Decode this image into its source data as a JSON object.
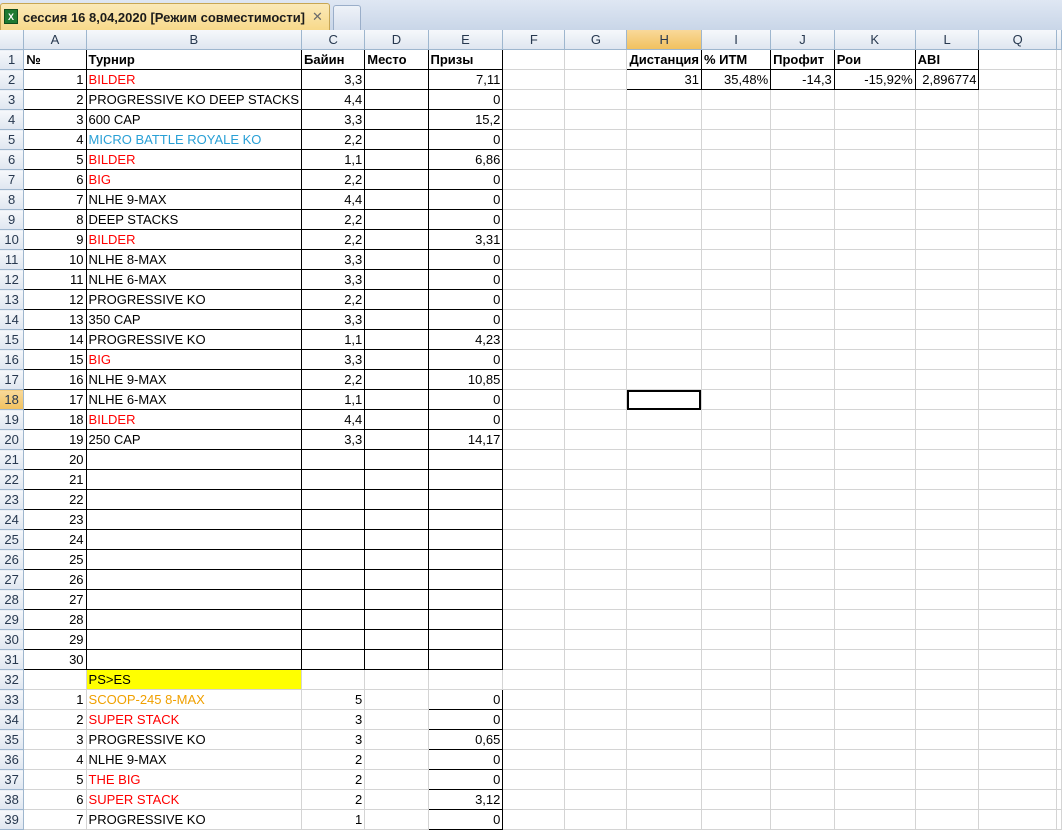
{
  "tab": {
    "title": "сессия 16 8,04,2020  [Режим совместимости]",
    "close": "✕"
  },
  "columns": [
    "A",
    "B",
    "C",
    "D",
    "E",
    "F",
    "G",
    "H",
    "I",
    "J",
    "K",
    "L",
    "Q"
  ],
  "header_row": {
    "A": "№",
    "B": "Турнир",
    "C": "Байин",
    "D": "Место",
    "E": "Призы",
    "H": "Дистанция",
    "I": "% ИТМ",
    "J": "Профит",
    "K": "Рои",
    "L": "ABI"
  },
  "summary_row": {
    "H": "31",
    "I": "35,48%",
    "J": "-14,3",
    "K": "-15,92%",
    "L": "2,896774"
  },
  "tournaments": [
    {
      "n": "1",
      "name": "BILDER",
      "color": "red",
      "buyin": "3,3",
      "prize": "7,11"
    },
    {
      "n": "2",
      "name": "PROGRESSIVE KO DEEP STACKS",
      "color": "black",
      "buyin": "4,4",
      "prize": "0"
    },
    {
      "n": "3",
      "name": "600 CAP",
      "color": "black",
      "buyin": "3,3",
      "prize": "15,2"
    },
    {
      "n": "4",
      "name": "MICRO BATTLE ROYALE KO",
      "color": "blue",
      "buyin": "2,2",
      "prize": "0"
    },
    {
      "n": "5",
      "name": "BILDER",
      "color": "red",
      "buyin": "1,1",
      "prize": "6,86"
    },
    {
      "n": "6",
      "name": "BIG",
      "color": "red",
      "buyin": "2,2",
      "prize": "0"
    },
    {
      "n": "7",
      "name": "NLHE 9-MAX",
      "color": "black",
      "buyin": "4,4",
      "prize": "0"
    },
    {
      "n": "8",
      "name": "DEEP STACKS",
      "color": "black",
      "buyin": "2,2",
      "prize": "0"
    },
    {
      "n": "9",
      "name": "BILDER",
      "color": "red",
      "buyin": "2,2",
      "prize": "3,31"
    },
    {
      "n": "10",
      "name": "NLHE 8-MAX",
      "color": "black",
      "buyin": "3,3",
      "prize": "0"
    },
    {
      "n": "11",
      "name": "NLHE 6-MAX",
      "color": "black",
      "buyin": "3,3",
      "prize": "0"
    },
    {
      "n": "12",
      "name": "PROGRESSIVE KO",
      "color": "black",
      "buyin": "2,2",
      "prize": "0"
    },
    {
      "n": "13",
      "name": "350 CAP",
      "color": "black",
      "buyin": "3,3",
      "prize": "0"
    },
    {
      "n": "14",
      "name": "PROGRESSIVE KO",
      "color": "black",
      "buyin": "1,1",
      "prize": "4,23"
    },
    {
      "n": "15",
      "name": "BIG",
      "color": "red",
      "buyin": "3,3",
      "prize": "0"
    },
    {
      "n": "16",
      "name": "NLHE 9-MAX",
      "color": "black",
      "buyin": "2,2",
      "prize": "10,85"
    },
    {
      "n": "17",
      "name": "NLHE 6-MAX",
      "color": "black",
      "buyin": "1,1",
      "prize": "0"
    },
    {
      "n": "18",
      "name": "BILDER",
      "color": "red",
      "buyin": "4,4",
      "prize": "0"
    },
    {
      "n": "19",
      "name": "250 CAP",
      "color": "black",
      "buyin": "3,3",
      "prize": "14,17"
    },
    {
      "n": "20",
      "name": "",
      "color": "black",
      "buyin": "",
      "prize": ""
    },
    {
      "n": "21",
      "name": "",
      "color": "black",
      "buyin": "",
      "prize": ""
    },
    {
      "n": "22",
      "name": "",
      "color": "black",
      "buyin": "",
      "prize": ""
    },
    {
      "n": "23",
      "name": "",
      "color": "black",
      "buyin": "",
      "prize": ""
    },
    {
      "n": "24",
      "name": "",
      "color": "black",
      "buyin": "",
      "prize": ""
    },
    {
      "n": "25",
      "name": "",
      "color": "black",
      "buyin": "",
      "prize": ""
    },
    {
      "n": "26",
      "name": "",
      "color": "black",
      "buyin": "",
      "prize": ""
    },
    {
      "n": "27",
      "name": "",
      "color": "black",
      "buyin": "",
      "prize": ""
    },
    {
      "n": "28",
      "name": "",
      "color": "black",
      "buyin": "",
      "prize": ""
    },
    {
      "n": "29",
      "name": "",
      "color": "black",
      "buyin": "",
      "prize": ""
    },
    {
      "n": "30",
      "name": "",
      "color": "black",
      "buyin": "",
      "prize": ""
    }
  ],
  "section2_label": "PS>ES",
  "section2": [
    {
      "n": "1",
      "name": "SCOOP-245 8-MAX",
      "color": "orange",
      "buyin": "5",
      "prize": "0"
    },
    {
      "n": "2",
      "name": "SUPER STACK",
      "color": "red",
      "buyin": "3",
      "prize": "0"
    },
    {
      "n": "3",
      "name": "PROGRESSIVE KO",
      "color": "black",
      "buyin": "3",
      "prize": "0,65"
    },
    {
      "n": "4",
      "name": "NLHE 9-MAX",
      "color": "black",
      "buyin": "2",
      "prize": "0"
    },
    {
      "n": "5",
      "name": "THE BIG",
      "color": "red",
      "buyin": "2",
      "prize": "0"
    },
    {
      "n": "6",
      "name": "SUPER STACK",
      "color": "red",
      "buyin": "2",
      "prize": "3,12"
    },
    {
      "n": "7",
      "name": "PROGRESSIVE KO",
      "color": "black",
      "buyin": "1",
      "prize": "0"
    }
  ],
  "selection": {
    "column": "H",
    "row": "18"
  },
  "colors": {
    "red": "#ff0000",
    "blue": "#29a0d6",
    "orange": "#f0a000",
    "highlight": "#ffff00",
    "tab": "#f7d98a",
    "header_selected": "#f1c15f"
  }
}
